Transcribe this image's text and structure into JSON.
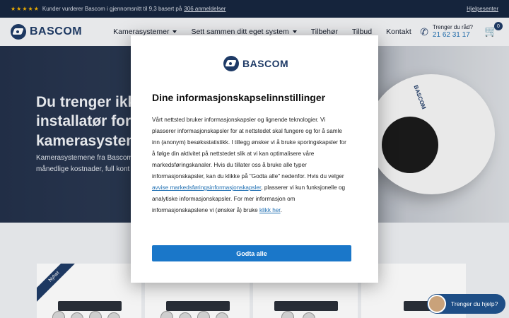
{
  "topbar": {
    "stars": "★★★★★",
    "rating_text": "Kunder vurderer Bascom i gjennomsnitt til 9,3 basert på",
    "rating_link": "306 anmeldelser",
    "help_link": "Hjelpesenter"
  },
  "header": {
    "logo_text": "BASCOM",
    "nav": [
      {
        "label": "Kamerasystemer",
        "dropdown": true
      },
      {
        "label": "Sett sammen ditt eget system",
        "dropdown": true
      },
      {
        "label": "Tilbehør",
        "dropdown": false
      },
      {
        "label": "Tilbud",
        "dropdown": false
      },
      {
        "label": "Kontakt",
        "dropdown": false
      }
    ],
    "advice_label": "Trenger du råd?",
    "phone": "21 62 31 17",
    "cart_count": "0"
  },
  "hero": {
    "title_lines": [
      "Du trenger ikke",
      "installatør for e",
      "kamerasystem"
    ],
    "sub_lines": [
      "Kamerasystemene fra Bascom",
      "månedlige kostnader, full kont"
    ],
    "camera_brand": "BASCOM"
  },
  "products": {
    "ribbon": "Nyhet"
  },
  "modal": {
    "logo_text": "BASCOM",
    "title": "Dine informasjonskapselinnstillinger",
    "body": {
      "l1": "Vårt nettsted bruker informasjonskapsler og lignende teknologier. Vi",
      "l2": "plasserer informasjonskapsler for at nettstedet skal fungere og for å samle",
      "l3": "inn (anonym) besøksstatistikk. I tillegg ønsker vi å bruke sporingskapsler for",
      "l4": "å følge din aktivitet på nettstedet slik at vi kan optimalisere våre",
      "l5": "markedsføringskanaler. Hvis du tillater oss å bruke alle typer",
      "l6": "informasjonskapsler, kan du klikke på \"Godta alle\" nedenfor. Hvis du velger",
      "l7_link": "avvise markedsføringsinformasjonskapsler",
      "l7_rest": ", plasserer vi kun funksjonelle og",
      "l8": "analytiske informasjonskapsler. For mer informasjon om",
      "l9_pre": "informasjonskapslene vi (ønsker å) bruke ",
      "l9_link": "klikk her",
      "l9_post": "."
    },
    "accept_label": "Godta alle"
  },
  "chat": {
    "label": "Trenger du hjelp?"
  },
  "colors": {
    "brand_navy": "#1e3a66",
    "accent_blue": "#1a77c9",
    "topbar_bg": "#16253f",
    "star": "#f5b400"
  }
}
